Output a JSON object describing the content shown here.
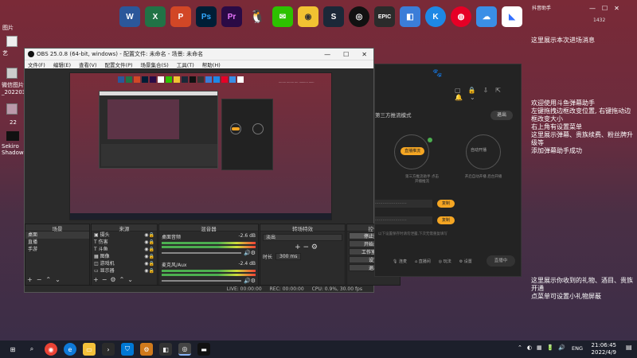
{
  "dock": {
    "apps": [
      {
        "name": "word",
        "glyph": "W",
        "color": "#2b579a"
      },
      {
        "name": "excel",
        "glyph": "X",
        "color": "#217346"
      },
      {
        "name": "powerpoint",
        "glyph": "P",
        "color": "#d24726"
      },
      {
        "name": "photoshop",
        "glyph": "Ps",
        "color": "#001e36"
      },
      {
        "name": "premiere",
        "glyph": "Pr",
        "color": "#2a0a45"
      },
      {
        "name": "qq",
        "glyph": "Q",
        "color": "#ffffff"
      },
      {
        "name": "wechat",
        "glyph": "✉",
        "color": "#2dc100"
      },
      {
        "name": "game",
        "glyph": "◉",
        "color": "#f1c232"
      },
      {
        "name": "steam",
        "glyph": "S",
        "color": "#1b2838"
      },
      {
        "name": "obs",
        "glyph": "◎",
        "color": "#111111"
      },
      {
        "name": "epic",
        "glyph": "EPIC",
        "color": "#2b2b2b"
      },
      {
        "name": "screenshot",
        "glyph": "◧",
        "color": "#3b7dd8"
      },
      {
        "name": "k-app",
        "glyph": "K",
        "color": "#1e88e5"
      },
      {
        "name": "netease",
        "glyph": "◍",
        "color": "#e60026"
      },
      {
        "name": "cloud",
        "glyph": "☁",
        "color": "#3a8ee6"
      },
      {
        "name": "feishu",
        "glyph": "◣",
        "color": "#ffffff"
      }
    ]
  },
  "desktop": {
    "top_left_label": "图片",
    "icon_labels": [
      "艺",
      "微信图片_2022031",
      "22",
      "Sekiro Shadows..."
    ]
  },
  "obs": {
    "title": "OBS 25.0.8 (64-bit, windows) - 配置文件: 未命名 - 场景: 未命名",
    "menu": [
      "文件(F)",
      "编辑(E)",
      "查看(V)",
      "配置文件(P)",
      "场景集合(S)",
      "工具(T)",
      "帮助(H)"
    ],
    "panels": {
      "scenes_header": "场景",
      "scenes": [
        "桌面",
        "直播",
        "手游"
      ],
      "sources_header": "来源",
      "sources": [
        "摄头",
        "伤害",
        "斗鱼",
        "图像",
        "游戏机",
        "显示器"
      ],
      "mixer_header": "混音器",
      "mixer": [
        {
          "name": "桌面音频",
          "db": "-2.6 dB"
        },
        {
          "name": "麦克风/Aux",
          "db": "-2.4 dB"
        }
      ],
      "transition_header": "转场特效",
      "transition_value": "淡出",
      "duration_label": "时长",
      "duration_value": "300 ms",
      "controls_header": "控件",
      "controls": [
        "停止推流",
        "开始录制",
        "工作室模式",
        "设置",
        "退出"
      ]
    },
    "status": {
      "live": "LIVE: 00:00:00",
      "rec": "REC: 00:00:00",
      "cpu": "CPU: 0.9%, 30.00 fps"
    }
  },
  "app": {
    "mode_label": "第三方推流模式",
    "exit_button": "退出",
    "push_label": "直播推流",
    "start_label": "自动开播",
    "caption_left": "第三方推流助手 点击开播推流",
    "caption_right": "开启自动开播 后台开播",
    "copy_btn": "复制",
    "note": "以下设置保存时请勿泄露,下次无需重复填写",
    "bottom_items": [
      "连麦",
      "直播间",
      "玩法",
      "设置"
    ],
    "stream_button": "直播中"
  },
  "right_text": {
    "top_line": "这里展示本次进场消息",
    "welcome": [
      "欢迎使用斗鱼弹幕助手",
      "左键拖拽边框改变位置, 右键拖动边框改变大小",
      "右上角有设置菜单",
      "这里展示弹幕、贵族续费、粉丝牌升级等",
      "添加弹幕助手成功"
    ],
    "bottom": [
      "这里展示你收到的礼物、酒目、贵族开通",
      "点菜单可设置小礼物屏蔽"
    ],
    "small_top": "抖音助手",
    "counter": "1432"
  },
  "taskbar": {
    "lang": "ENG",
    "time": "21:06:45",
    "date": "2022/4/9"
  }
}
